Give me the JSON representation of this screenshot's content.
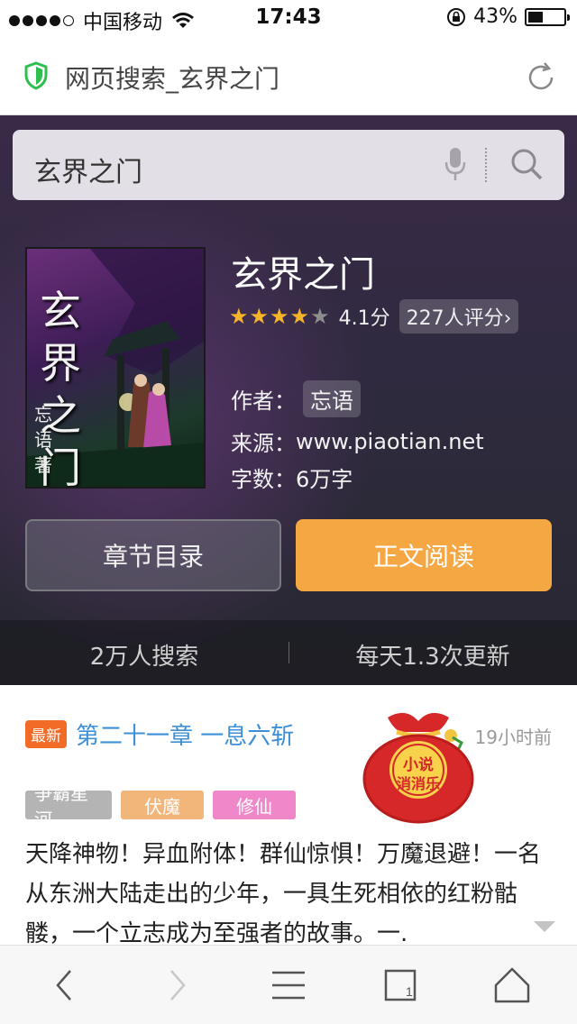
{
  "status_bar": {
    "carrier": "中国移动",
    "time": "17:43",
    "battery": "43%",
    "battery_level": 0.43
  },
  "browser": {
    "page_title": "网页搜索_玄界之门"
  },
  "search": {
    "query": "玄界之门"
  },
  "book": {
    "title": "玄界之门",
    "cover_title": "玄界之门",
    "cover_author": "忘语著",
    "rating_stars": 4,
    "rating_max": 5,
    "score": "4.1分",
    "reviews": "227人评分",
    "author_label": "作者：",
    "author": "忘语",
    "source_label": "来源：",
    "source": "www.piaotian.net",
    "words_label": "字数：",
    "words": "6万字"
  },
  "actions": {
    "toc_label": "章节目录",
    "read_label": "正文阅读"
  },
  "stats": {
    "searches": "2万人搜索",
    "updates": "每天1.3次更新"
  },
  "latest": {
    "badge": "最新",
    "chapter": "第二十一章 一息六斩",
    "time": "19小时前"
  },
  "tags": [
    "争霸星河",
    "伏魔",
    "修仙"
  ],
  "description": "天降神物！异血附体！群仙惊惧！万魔退避！一名从东洲大陆走出的少年，一具生死相依的红粉骷髅，一个立志成为至强者的故事。一.",
  "promo": {
    "text_line1": "小说",
    "text_line2": "消消乐"
  },
  "colors": {
    "accent_orange": "#f5a743",
    "link_blue": "#3d8fd6",
    "badge_orange": "#f26b27"
  }
}
